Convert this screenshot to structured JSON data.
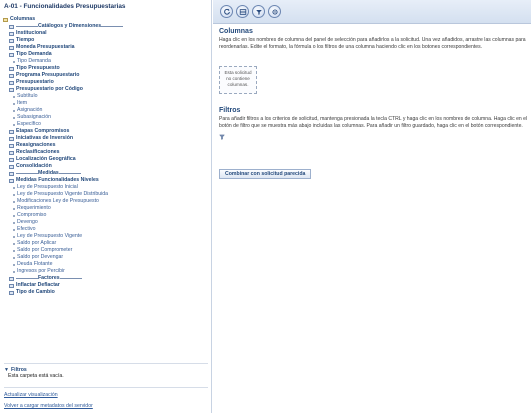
{
  "panel_title": "A-01 - Funcionalidades Presupuestarias",
  "tree": [
    {
      "kind": "root",
      "label": "Columnas"
    },
    {
      "kind": "sep",
      "label": "Catálogos y Dimensiones"
    },
    {
      "kind": "folder",
      "label": "Institucional"
    },
    {
      "kind": "folder",
      "label": "Tiempo"
    },
    {
      "kind": "folder",
      "label": "Moneda Presupuestaria"
    },
    {
      "kind": "folder",
      "label": "Tipo Demanda"
    },
    {
      "kind": "leaf",
      "label": "Tipo Demanda"
    },
    {
      "kind": "folder",
      "label": "Tipo Presupuesto"
    },
    {
      "kind": "folder",
      "label": "Programa Presupuestario"
    },
    {
      "kind": "folder",
      "label": "Presupuestario"
    },
    {
      "kind": "folder",
      "label": "Presupuestario por Código"
    },
    {
      "kind": "leaf",
      "label": "Subtítulo"
    },
    {
      "kind": "leaf",
      "label": "Item"
    },
    {
      "kind": "leaf",
      "label": "Asignación"
    },
    {
      "kind": "leaf",
      "label": "Subasignación"
    },
    {
      "kind": "leaf",
      "label": "Específico"
    },
    {
      "kind": "folder",
      "label": "Etapas Compromisos"
    },
    {
      "kind": "folder",
      "label": "Iniciativas de Inversión"
    },
    {
      "kind": "folder",
      "label": "Reasignaciones"
    },
    {
      "kind": "folder",
      "label": "Reclasificaciones"
    },
    {
      "kind": "folder",
      "label": "Localización Geográfica"
    },
    {
      "kind": "folder",
      "label": "Consolidación"
    },
    {
      "kind": "sep",
      "label": "Medidas"
    },
    {
      "kind": "folder",
      "label": "Medidas Funcionalidades Niveles"
    },
    {
      "kind": "leaf",
      "label": "Ley de Presupuesto Inicial"
    },
    {
      "kind": "leaf",
      "label": "Ley de Presupuesto Vigente Distribuida"
    },
    {
      "kind": "leaf",
      "label": "Modificaciones Ley de Presupuesto"
    },
    {
      "kind": "leaf",
      "label": "Requerimiento"
    },
    {
      "kind": "leaf",
      "label": "Compromiso"
    },
    {
      "kind": "leaf",
      "label": "Devengo"
    },
    {
      "kind": "leaf",
      "label": "Efectivo"
    },
    {
      "kind": "leaf",
      "label": "Ley de Presupuesto Vigente"
    },
    {
      "kind": "leaf",
      "label": "Saldo por Aplicar"
    },
    {
      "kind": "leaf",
      "label": "Saldo por Comprometer"
    },
    {
      "kind": "leaf",
      "label": "Saldo por Devengar"
    },
    {
      "kind": "leaf",
      "label": "Deuda Flotante"
    },
    {
      "kind": "leaf",
      "label": "Ingresos por Percibir"
    },
    {
      "kind": "sep",
      "label": "Factores"
    },
    {
      "kind": "folder",
      "label": "Inflactar Deflactar"
    },
    {
      "kind": "folder",
      "label": "Tipo de Cambio"
    }
  ],
  "filters_section": {
    "title": "Filtros",
    "empty_message": "Esta carpeta está vacía."
  },
  "links": {
    "refresh": "Actualizar visualización",
    "reload_metadata": "Volver a cargar metadatos del servidor"
  },
  "toolbar_icons": [
    "refresh-icon",
    "table-icon",
    "filter-icon",
    "settings-icon"
  ],
  "columns_section": {
    "title": "Columnas",
    "line1": "Haga clic en los nombres de columna del panel de selección para añadirlos a la solicitud. Una vez añadidos, arrastre las columnas para",
    "line2": "reordenarlas. Edite el formato, la fórmula o los filtros de una columna haciendo clic en los botones correspondientes.",
    "drop_line1": "Esta solicitud",
    "drop_line2": "no contiene",
    "drop_line3": "columnas."
  },
  "filtros_section": {
    "title": "Filtros",
    "line1": "Para añadir filtros a los criterios de solicitud, mantenga presionada la tecla CTRL y haga clic en los nombres de columna. Haga clic en el",
    "line2": "botón de filtro que se muestra más abajo incluidas las columnas. Para añadir un filtro guardado, haga clic en el botón correspondiente."
  },
  "combine_button": "Combinar con solicitud parecida",
  "colors": {
    "link": "#2f5a9a",
    "heading": "#244a7c",
    "toolbar_top": "#e7eef8",
    "toolbar_bottom": "#d4e0f0"
  }
}
